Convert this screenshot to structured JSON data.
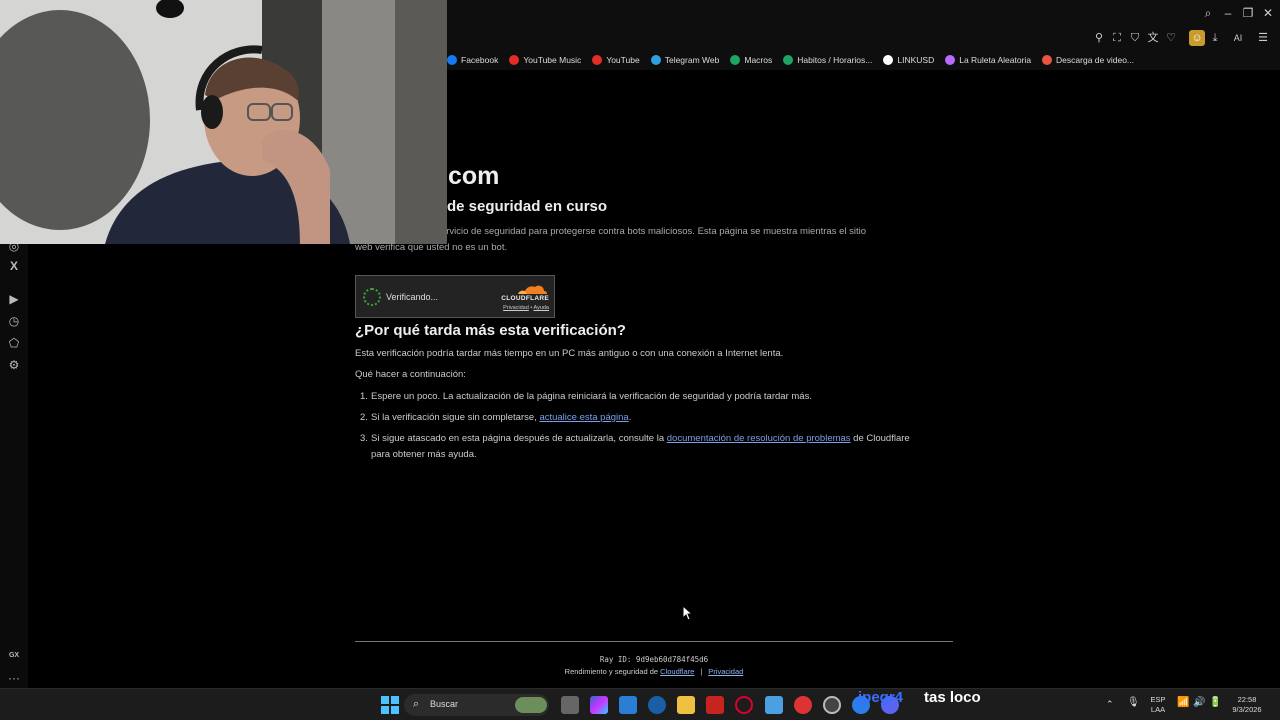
{
  "bookmarks": [
    {
      "label": "Facebook",
      "color": "#1877f2"
    },
    {
      "label": "YouTube Music",
      "color": "#e52d27"
    },
    {
      "label": "YouTube",
      "color": "#e52d27"
    },
    {
      "label": "Telegram Web",
      "color": "#2aa3dd"
    },
    {
      "label": "Macros",
      "color": "#1fa463"
    },
    {
      "label": "Habitos / Horarios...",
      "color": "#1fa463"
    },
    {
      "label": "LINKUSD",
      "color": "#ffffff"
    },
    {
      "label": "La Ruleta Aleatoria",
      "color": "#b66dff"
    },
    {
      "label": "Descarga de video...",
      "color": "#e8563f"
    }
  ],
  "toolbar": {
    "ai_label": "AI"
  },
  "page": {
    "site_title": "com",
    "security_heading": "de seguridad en curso",
    "security_desc_line1": "un servicio de seguridad para protegerse contra bots maliciosos. Esta página se muestra mientras el sitio",
    "security_desc_line2": "web verifica que usted no es un bot.",
    "widget_status": "Verificando...",
    "widget_brand": "CLOUDFLARE",
    "widget_privacy": "Privacidad",
    "widget_sep": " • ",
    "widget_help": "Ayuda",
    "why_heading": "¿Por qué tarda más esta verificación?",
    "why_desc": "Esta verificación podría tardar más tiempo en un PC más antiguo o con una conexión a Internet lenta.",
    "next_label": "Qué hacer a continuación:",
    "step1": "Espere un poco. La actualización de la página reiniciará la verificación de seguridad y podría tardar más.",
    "step2_pre": "Si la verificación sigue sin completarse, ",
    "step2_link": "actualice esta página",
    "step2_post": ".",
    "step3_pre": "Si sigue atascado en esta página después de actualizarla, consulte la ",
    "step3_link": "documentación de resolución de problemas",
    "step3_post": " de Cloudflare",
    "step3_line2": "para obtener más ayuda.",
    "ray_id": "Ray ID: 9d9eb60d784f45d6",
    "perf_pre": "Rendimiento y seguridad de ",
    "perf_link": "Cloudflare",
    "perf_sep": "|",
    "perf_privacy": "Privacidad"
  },
  "sidebar": {
    "gx_label": "GX",
    "more_label": "···"
  },
  "taskbar": {
    "search_placeholder": "Buscar",
    "lang_top": "ESP",
    "lang_bottom": "LAA",
    "time": "22:58",
    "date": "9/3/2026",
    "overlay_text_blue": "jpegr4",
    "overlay_text_white": "tas loco"
  }
}
